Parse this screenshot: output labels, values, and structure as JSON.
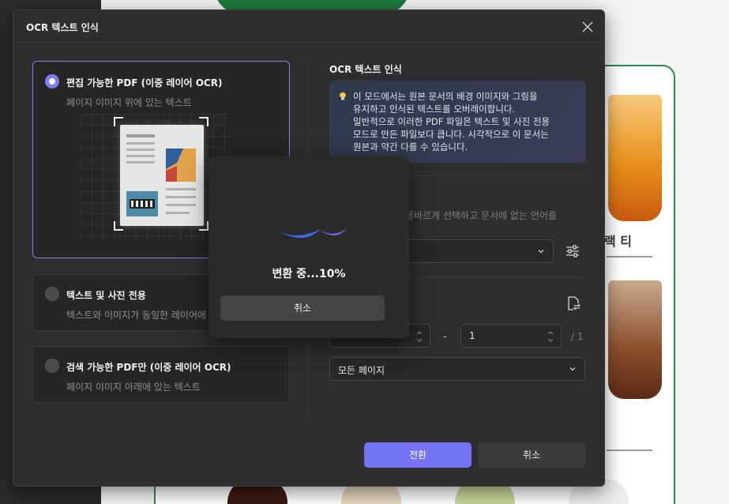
{
  "dialog": {
    "title": "OCR 텍스트 인식"
  },
  "options": [
    {
      "title": "편집 가능한 PDF (이중 레이어 OCR)",
      "desc": "페이지 이미지 위에 있는 텍스트",
      "selected": true
    },
    {
      "title": "텍스트 및 사진 전용",
      "desc": "텍스트와 이미지가 동일한 레이어에",
      "selected": false
    },
    {
      "title": "검색 가능한 PDF만 (이중 레이어 OCR)",
      "desc": "페이지 이미지 아래에 있는 텍스트",
      "selected": false
    }
  ],
  "right_panel": {
    "section_title": "OCR 텍스트 인식",
    "info_lines": [
      "이 모드에서는 원본 문서의 배경 이미지와 그림을",
      "유지하고 인식된 텍스트를 오버레이합니다.",
      "일반적으로 이러한 PDF 파일은 텍스트 및 사진 전용",
      "모드로 만든 파일보다 큽니다. 시각적으로 이 문서는",
      "원본과 약간 다를 수 있습니다."
    ],
    "language_hint": "올바르게 선택하고 문서에 없는 언어를",
    "page_to": "1",
    "page_total": "/ 1",
    "range_dash": "-",
    "page_scope": "모든 페이지"
  },
  "buttons": {
    "convert": "전환",
    "cancel": "취소"
  },
  "progress": {
    "text": "변환 중...10%",
    "percent": 10,
    "cancel": "취소"
  },
  "background_doc": {
    "label_1": "랙 티"
  },
  "colors": {
    "accent": "#7473f4",
    "dialog_bg": "#2e2e2e",
    "doc_green": "#2e8b48"
  }
}
